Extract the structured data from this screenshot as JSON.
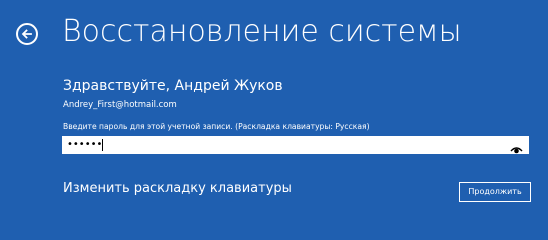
{
  "colors": {
    "background": "#1F5FB0",
    "text": "#FFFFFF",
    "field_background": "#FFFFFF"
  },
  "header": {
    "back_icon": "back-arrow-circle-icon",
    "title": "Восстановление системы"
  },
  "account": {
    "greeting": "Здравствуйте, Андрей Жуков",
    "email": "Andrey_First@hotmail.com"
  },
  "password": {
    "prompt": "Введите пароль для этой учетной записи. (Раскладка клавиатуры: Русская)",
    "masked_value": "••••••",
    "reveal_icon": "eye-icon"
  },
  "actions": {
    "change_layout_label": "Изменить раскладку клавиатуры",
    "continue_label": "Продолжить"
  }
}
